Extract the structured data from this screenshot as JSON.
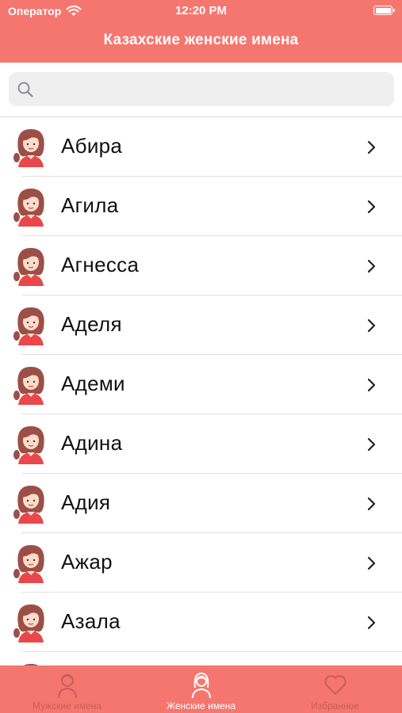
{
  "status_bar": {
    "carrier": "Оператор",
    "time": "12:20 PM"
  },
  "nav": {
    "title": "Казахские женские имена"
  },
  "search": {
    "placeholder": ""
  },
  "names": [
    "Абира",
    "Агила",
    "Агнесса",
    "Аделя",
    "Адеми",
    "Адина",
    "Адия",
    "Ажар",
    "Азала",
    ""
  ],
  "tabs": [
    {
      "label": "Мужские имена",
      "icon": "boy-icon",
      "active": false
    },
    {
      "label": "Женские имена",
      "icon": "girl-icon",
      "active": true
    },
    {
      "label": "Избранное",
      "icon": "heart-icon",
      "active": false
    }
  ],
  "colors": {
    "accent": "#f5766f",
    "inactive_tab": "#c95e58",
    "avatar_hair": "#9c4f46",
    "avatar_shirt": "#e9474a"
  }
}
